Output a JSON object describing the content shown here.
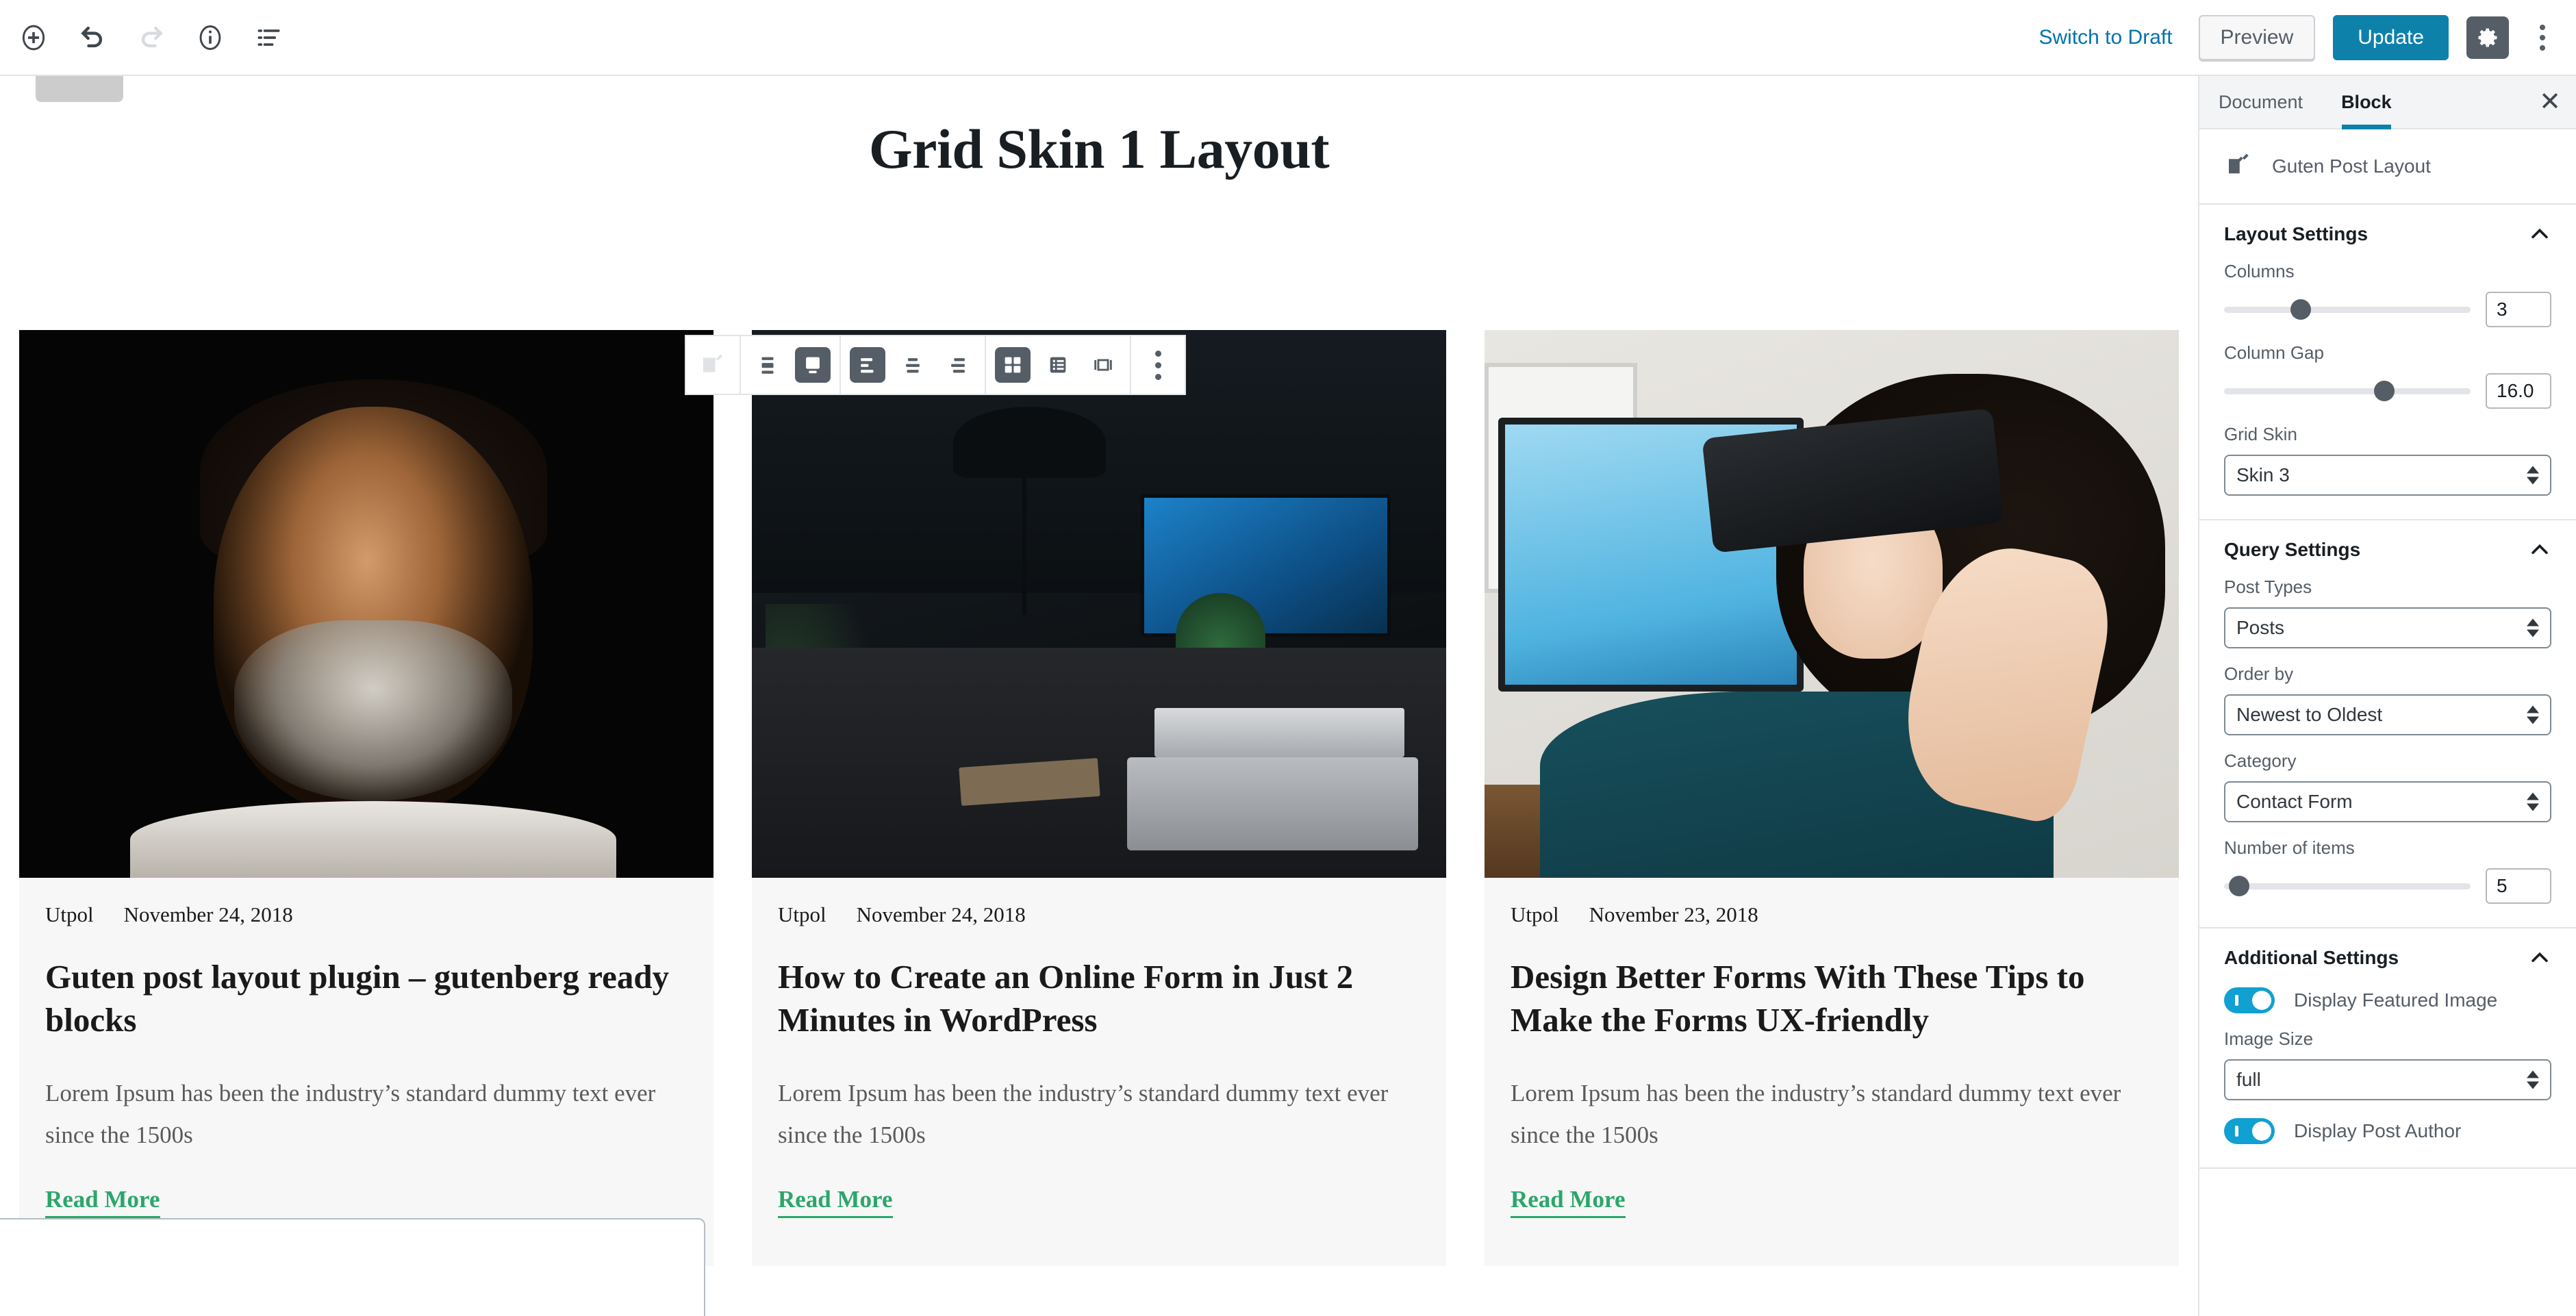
{
  "topbar": {
    "left_icons": [
      {
        "name": "add-block-icon",
        "title": "Add block"
      },
      {
        "name": "undo-icon",
        "title": "Undo"
      },
      {
        "name": "redo-icon",
        "title": "Redo"
      },
      {
        "name": "info-icon",
        "title": "Content structure"
      },
      {
        "name": "block-navigation-icon",
        "title": "Block navigation"
      }
    ],
    "switch_to_draft": "Switch to Draft",
    "preview": "Preview",
    "update": "Update",
    "settings_icon": "gear-icon",
    "more_icon": "more-vertical-icon"
  },
  "editor": {
    "post_title": "Grid Skin 1 Layout",
    "block_toolbar": [
      {
        "name": "block-type-icon",
        "label": "Guten Post Layout",
        "active": false
      },
      {
        "name": "align-none-icon",
        "label": "None",
        "active": false
      },
      {
        "name": "align-center-block-icon",
        "label": "Wide width",
        "active": true
      },
      {
        "name": "align-text-left-icon",
        "label": "Align text left",
        "active": true
      },
      {
        "name": "align-text-center-icon",
        "label": "Align text center",
        "active": false
      },
      {
        "name": "align-text-right-icon",
        "label": "Align text right",
        "active": false
      },
      {
        "name": "grid-view-icon",
        "label": "Grid view",
        "active": true
      },
      {
        "name": "list-view-icon",
        "label": "List view",
        "active": false
      },
      {
        "name": "masonry-view-icon",
        "label": "Masonry view",
        "active": false
      },
      {
        "name": "more-options-icon",
        "label": "More options",
        "active": false
      }
    ]
  },
  "posts": [
    {
      "author": "Utpol",
      "date": "November 24, 2018",
      "title": "Guten post layout plugin – gutenberg ready blocks",
      "excerpt": "Lorem Ipsum has been the industry’s standard dummy text ever since the 1500s",
      "read_more": "Read More",
      "image_alt": "portrait-of-smiling-bearded-man"
    },
    {
      "author": "Utpol",
      "date": "November 24, 2018",
      "title": "How to Create an Online Form in Just 2 Minutes in WordPress",
      "excerpt": "Lorem Ipsum has been the industry’s standard dummy text ever since the 1500s",
      "read_more": "Read More",
      "image_alt": "dark-desk-workspace-with-laptop-and-monitor"
    },
    {
      "author": "Utpol",
      "date": "November 23, 2018",
      "title": "Design Better Forms With These Tips to Make the Forms UX-friendly",
      "excerpt": "Lorem Ipsum has been the industry’s standard dummy text ever since the 1500s",
      "read_more": "Read More",
      "image_alt": "woman-wearing-vr-headset-at-desk"
    }
  ],
  "sidebar": {
    "tabs": [
      {
        "label": "Document",
        "active": false
      },
      {
        "label": "Block",
        "active": true
      }
    ],
    "close_label": "✕",
    "block_name": "Guten Post Layout",
    "block_icon": "edit-pencil-square-icon",
    "sections": [
      {
        "title": "Layout Settings",
        "expanded": true,
        "controls": [
          {
            "type": "range",
            "label": "Columns",
            "value": "3",
            "pct": 31
          },
          {
            "type": "range",
            "label": "Column Gap",
            "value": "16.0",
            "pct": 65
          },
          {
            "type": "select",
            "label": "Grid Skin",
            "value": "Skin 3"
          }
        ]
      },
      {
        "title": "Query Settings",
        "expanded": true,
        "controls": [
          {
            "type": "select",
            "label": "Post Types",
            "value": "Posts"
          },
          {
            "type": "select",
            "label": "Order by",
            "value": "Newest to Oldest"
          },
          {
            "type": "select",
            "label": "Category",
            "value": "Contact Form"
          },
          {
            "type": "range",
            "label": "Number of items",
            "value": "5",
            "pct": 6
          }
        ]
      },
      {
        "title": "Additional Settings",
        "expanded": true,
        "controls": [
          {
            "type": "toggle",
            "label": "Display Featured Image",
            "on": true
          },
          {
            "type": "select",
            "label": "Image Size",
            "value": "full"
          },
          {
            "type": "toggle",
            "label": "Display Post Author",
            "on": true
          }
        ]
      }
    ]
  },
  "colors": {
    "accent_blue": "#0e81ab",
    "link_blue": "#0073aa",
    "toggle_on": "#11a0d2",
    "read_more_green": "#2aa76a",
    "gray_dark": "#555d66",
    "border": "#e2e4e7"
  }
}
